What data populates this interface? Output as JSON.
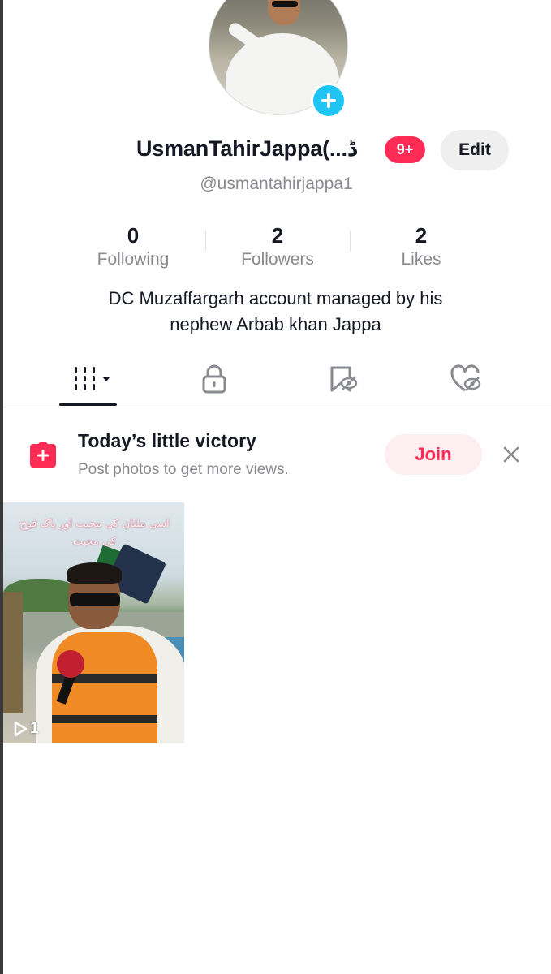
{
  "profile": {
    "display_name": "UsmanTahirJappa(...ڈ",
    "notification_badge": "9+",
    "edit_label": "Edit",
    "handle": "@usmantahirjappa1",
    "bio_line1": "DC Muzaffargarh account managed by his",
    "bio_line2": "nephew Arbab khan Jappa"
  },
  "stats": [
    {
      "value": "0",
      "label": "Following"
    },
    {
      "value": "2",
      "label": "Followers"
    },
    {
      "value": "2",
      "label": "Likes"
    }
  ],
  "tabs": [
    {
      "icon": "grid-icon",
      "active": true
    },
    {
      "icon": "lock-icon",
      "active": false
    },
    {
      "icon": "bookmark-hidden-icon",
      "active": false
    },
    {
      "icon": "heart-hidden-icon",
      "active": false
    }
  ],
  "promo": {
    "title": "Today’s little victory",
    "subtitle": "Post photos to get more views.",
    "join_label": "Join"
  },
  "videos": [
    {
      "overlay_text": "اسی ملتان کی محبت اور پاک فوج کی محبت",
      "play_count": "1"
    }
  ],
  "colors": {
    "accent": "#fe2c55",
    "avatar_plus": "#20c4f4",
    "secondary_text": "#8a8b91"
  }
}
